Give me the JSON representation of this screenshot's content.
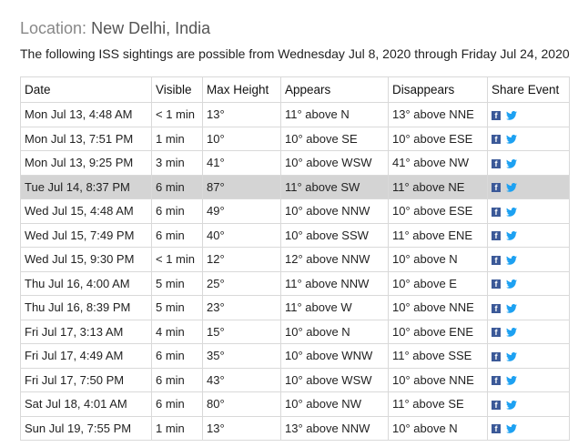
{
  "location": {
    "label": "Location:",
    "value": "New Delhi, India"
  },
  "subtitle": "The following ISS sightings are possible from Wednesday Jul 8, 2020 through Friday Jul 24, 2020",
  "table": {
    "headers": [
      "Date",
      "Visible",
      "Max Height",
      "Appears",
      "Disappears",
      "Share Event"
    ],
    "rows": [
      {
        "date": "Mon Jul 13, 4:48 AM",
        "visible": "< 1 min",
        "max_height": "13°",
        "appears": "11° above N",
        "disappears": "13° above NNE",
        "highlighted": false
      },
      {
        "date": "Mon Jul 13, 7:51 PM",
        "visible": "1 min",
        "max_height": "10°",
        "appears": "10° above SE",
        "disappears": "10° above ESE",
        "highlighted": false
      },
      {
        "date": "Mon Jul 13, 9:25 PM",
        "visible": "3 min",
        "max_height": "41°",
        "appears": "10° above WSW",
        "disappears": "41° above NW",
        "highlighted": false
      },
      {
        "date": "Tue Jul 14, 8:37 PM",
        "visible": "6 min",
        "max_height": "87°",
        "appears": "11° above SW",
        "disappears": "11° above NE",
        "highlighted": true
      },
      {
        "date": "Wed Jul 15, 4:48 AM",
        "visible": "6 min",
        "max_height": "49°",
        "appears": "10° above NNW",
        "disappears": "10° above ESE",
        "highlighted": false
      },
      {
        "date": "Wed Jul 15, 7:49 PM",
        "visible": "6 min",
        "max_height": "40°",
        "appears": "10° above SSW",
        "disappears": "11° above ENE",
        "highlighted": false
      },
      {
        "date": "Wed Jul 15, 9:30 PM",
        "visible": "< 1 min",
        "max_height": "12°",
        "appears": "12° above NNW",
        "disappears": "10° above N",
        "highlighted": false
      },
      {
        "date": "Thu Jul 16, 4:00 AM",
        "visible": "5 min",
        "max_height": "25°",
        "appears": "11° above NNW",
        "disappears": "10° above E",
        "highlighted": false
      },
      {
        "date": "Thu Jul 16, 8:39 PM",
        "visible": "5 min",
        "max_height": "23°",
        "appears": "11° above W",
        "disappears": "10° above NNE",
        "highlighted": false
      },
      {
        "date": "Fri Jul 17, 3:13 AM",
        "visible": "4 min",
        "max_height": "15°",
        "appears": "10° above N",
        "disappears": "10° above ENE",
        "highlighted": false
      },
      {
        "date": "Fri Jul 17, 4:49 AM",
        "visible": "6 min",
        "max_height": "35°",
        "appears": "10° above WNW",
        "disappears": "11° above SSE",
        "highlighted": false
      },
      {
        "date": "Fri Jul 17, 7:50 PM",
        "visible": "6 min",
        "max_height": "43°",
        "appears": "10° above WSW",
        "disappears": "10° above NNE",
        "highlighted": false
      },
      {
        "date": "Sat Jul 18, 4:01 AM",
        "visible": "6 min",
        "max_height": "80°",
        "appears": "10° above NW",
        "disappears": "11° above SE",
        "highlighted": false
      },
      {
        "date": "Sun Jul 19, 7:55 PM",
        "visible": "1 min",
        "max_height": "13°",
        "appears": "13° above NNW",
        "disappears": "10° above N",
        "highlighted": false
      }
    ]
  },
  "share_icons": [
    "facebook-icon",
    "twitter-icon"
  ],
  "colors": {
    "facebook": "#3b5998",
    "twitter": "#1da1f2",
    "highlight_row": "#d4d4d4",
    "border": "#d9d9d9"
  }
}
